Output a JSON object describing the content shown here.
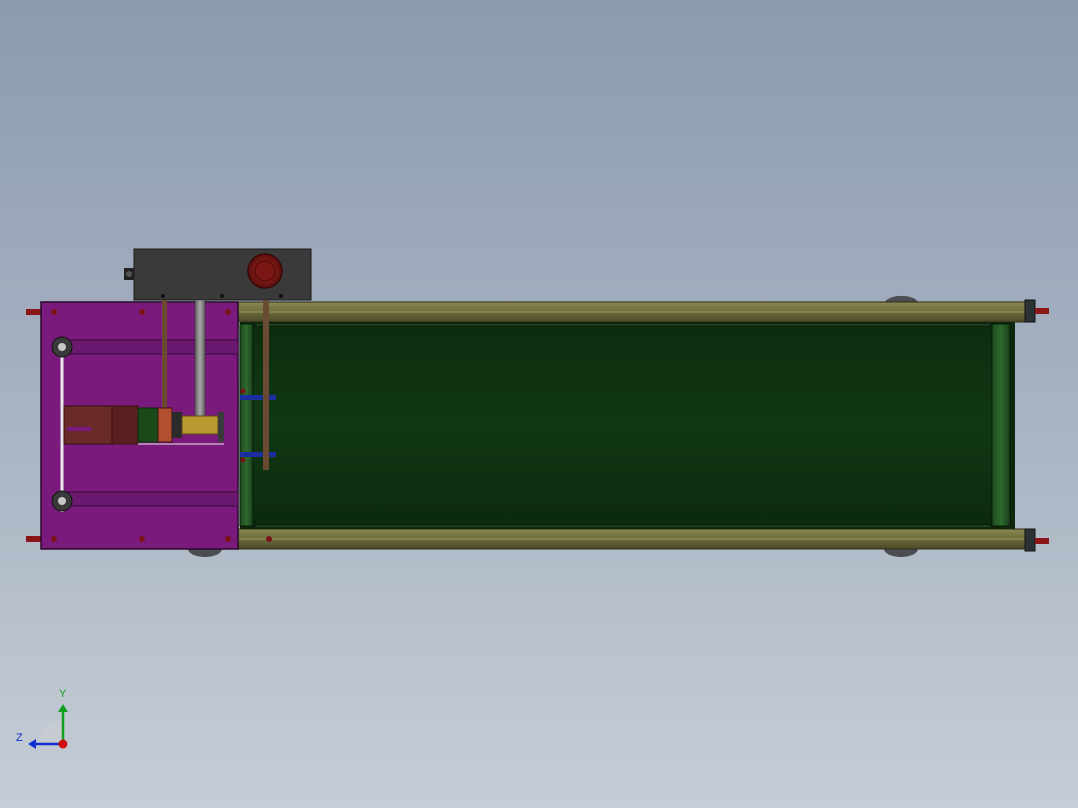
{
  "viewport": {
    "background_top": "#8b9bb0",
    "background_bottom": "#c6cdd6"
  },
  "model": {
    "frame_color": "#6b6a3c",
    "belt_color": "#0f3310",
    "motor_plate_color": "#7a1a7c",
    "control_box_color": "#3a3a3a",
    "stop_button_color": "#8a1a18",
    "bolt_color": "#7a1418"
  },
  "triad": {
    "x_axis_color": "#d01010",
    "y_axis_color": "#10a020",
    "z_axis_color": "#1030d0",
    "y_label": "Y",
    "z_label": "Z"
  }
}
